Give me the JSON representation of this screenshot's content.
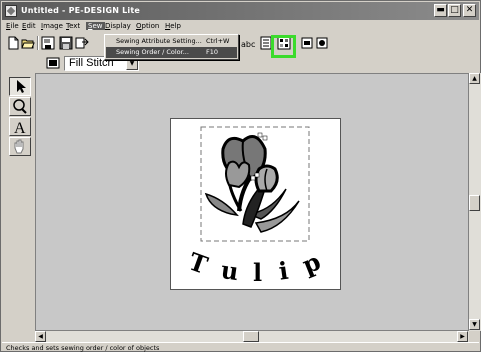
{
  "window": {
    "title": "Untitled - PE-DESIGN Lite",
    "controls": [
      "minimize",
      "maximize",
      "close"
    ]
  },
  "menubar": {
    "items": [
      {
        "key": "E",
        "rest": "ile",
        "label": "File"
      },
      {
        "key": "E",
        "rest": "dit",
        "label": "Edit"
      },
      {
        "key": "I",
        "rest": "mage",
        "label": "Image"
      },
      {
        "key": "T",
        "rest": "ext",
        "label": "Text"
      },
      {
        "key": "S",
        "rest": "ew",
        "label": "Sew"
      },
      {
        "key": "D",
        "rest": "isplay",
        "label": "Display"
      },
      {
        "key": "O",
        "rest": "ption",
        "label": "Option"
      },
      {
        "key": "H",
        "rest": "elp",
        "label": "Help"
      }
    ],
    "active": "Sew"
  },
  "sew_menu": {
    "items": [
      {
        "label": "Sewing Attribute Setting...",
        "shortcut": "Ctrl+W"
      },
      {
        "label": "Sewing Order / Color...",
        "shortcut": "F10"
      }
    ],
    "selected_index": 1
  },
  "toolbar2": {
    "stitch_select": {
      "value": "Fill Stitch"
    }
  },
  "design": {
    "text": "Tulip",
    "letters": [
      "T",
      "u",
      "l",
      "i",
      "p"
    ]
  },
  "statusbar": {
    "text": "Checks and sets sewing order / color of objects"
  },
  "colors": {
    "highlight": "#3bdb2c",
    "titlebar": "#5a5a5a",
    "canvas": "#c8c8c8"
  },
  "icons": {
    "toolbar": [
      "new-icon",
      "open-icon",
      "save-icon",
      "save-as-icon",
      "sewing-order-icon",
      "preview-icon",
      "write-card-icon"
    ],
    "tools": [
      "arrow-select-icon",
      "zoom-icon",
      "text-icon",
      "hand-icon"
    ]
  }
}
